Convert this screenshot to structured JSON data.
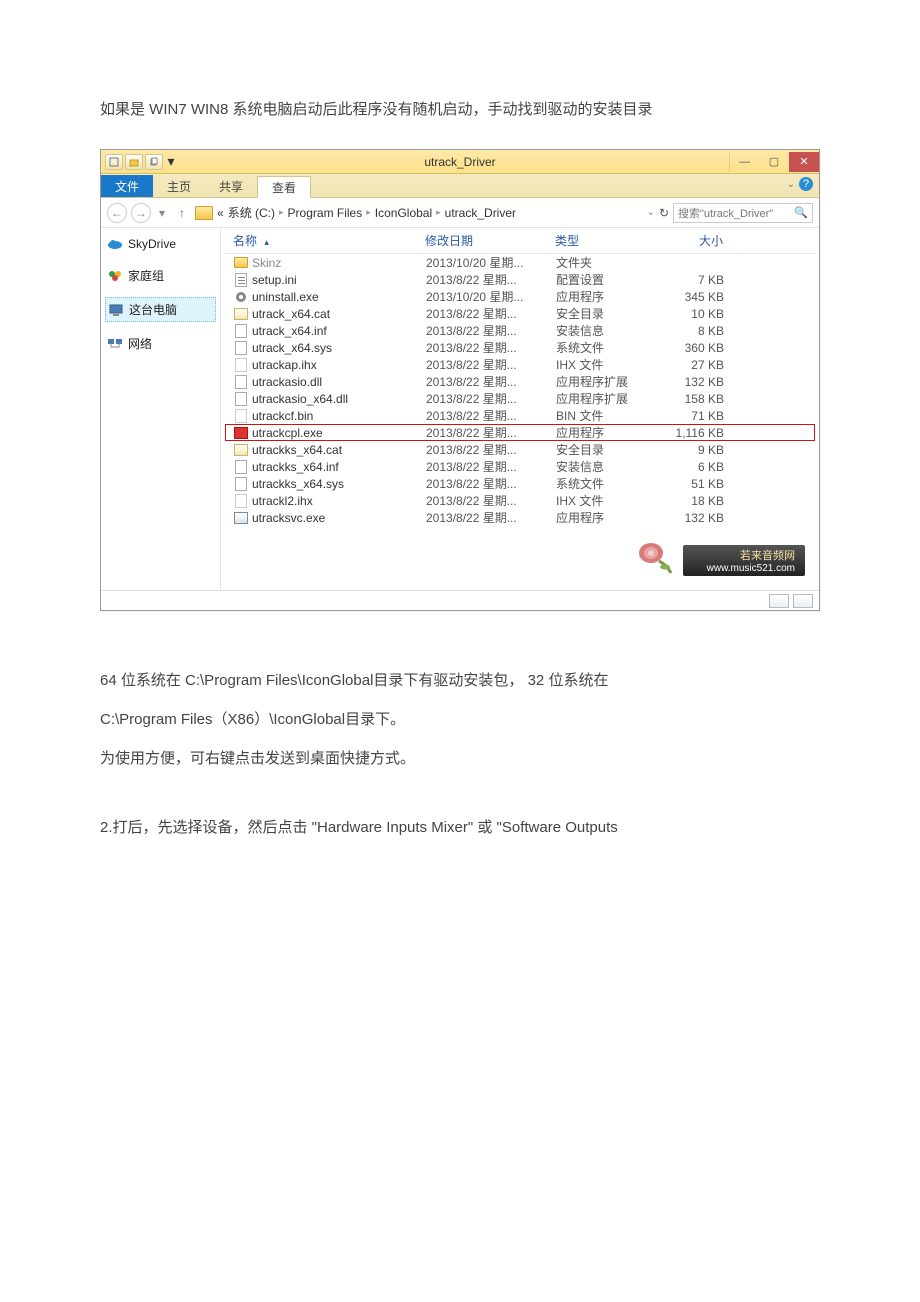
{
  "doc": {
    "line1": "如果是 WIN7  WIN8 系统电脑启动后此程序没有随机启动，手动找到驱动的安装目录",
    "line2": "64 位系统在 C:\\Program Files\\IconGlobal目录下有驱动安装包， 32 位系统在",
    "line3": "C:\\Program Files（X86）\\IconGlobal目录下。",
    "line4": "为使用方便，可右键点击发送到桌面快捷方式。",
    "line5": "2.打后，先选择设备，然后点击 \"Hardware Inputs Mixer\" 或 \"Software Outputs"
  },
  "window": {
    "title": "utrack_Driver",
    "ribbon": {
      "file": "文件",
      "home": "主页",
      "share": "共享",
      "view": "查看"
    },
    "breadcrumb": {
      "prefix": "«",
      "seg1": "系统 (C:)",
      "seg2": "Program Files",
      "seg3": "IconGlobal",
      "seg4": "utrack_Driver"
    },
    "nav": {
      "search_placeholder": "搜索\"utrack_Driver\""
    },
    "columns": {
      "name": "名称",
      "date": "修改日期",
      "type": "类型",
      "size": "大小"
    },
    "sidebar": {
      "skydrive": "SkyDrive",
      "homegroup": "家庭组",
      "thispc": "这台电脑",
      "network": "网络"
    },
    "files": [
      {
        "icon": "folder",
        "name": "Skinz",
        "date": "2013/10/20 星期...",
        "type": "文件夹",
        "size": "",
        "sel": true
      },
      {
        "icon": "ini",
        "name": "setup.ini",
        "date": "2013/8/22 星期...",
        "type": "配置设置",
        "size": "7 KB"
      },
      {
        "icon": "gear",
        "name": "uninstall.exe",
        "date": "2013/10/20 星期...",
        "type": "应用程序",
        "size": "345 KB"
      },
      {
        "icon": "cat",
        "name": "utrack_x64.cat",
        "date": "2013/8/22 星期...",
        "type": "安全目录",
        "size": "10 KB"
      },
      {
        "icon": "inf",
        "name": "utrack_x64.inf",
        "date": "2013/8/22 星期...",
        "type": "安装信息",
        "size": "8 KB"
      },
      {
        "icon": "sys",
        "name": "utrack_x64.sys",
        "date": "2013/8/22 星期...",
        "type": "系统文件",
        "size": "360 KB"
      },
      {
        "icon": "blank",
        "name": "utrackap.ihx",
        "date": "2013/8/22 星期...",
        "type": "IHX 文件",
        "size": "27 KB"
      },
      {
        "icon": "sys",
        "name": "utrackasio.dll",
        "date": "2013/8/22 星期...",
        "type": "应用程序扩展",
        "size": "132 KB"
      },
      {
        "icon": "sys",
        "name": "utrackasio_x64.dll",
        "date": "2013/8/22 星期...",
        "type": "应用程序扩展",
        "size": "158 KB"
      },
      {
        "icon": "blank",
        "name": "utrackcf.bin",
        "date": "2013/8/22 星期...",
        "type": "BIN 文件",
        "size": "71 KB"
      },
      {
        "icon": "redexe",
        "name": "utrackcpl.exe",
        "date": "2013/8/22 星期...",
        "type": "应用程序",
        "size": "1,116 KB",
        "red": true
      },
      {
        "icon": "cat",
        "name": "utrackks_x64.cat",
        "date": "2013/8/22 星期...",
        "type": "安全目录",
        "size": "9 KB"
      },
      {
        "icon": "inf",
        "name": "utrackks_x64.inf",
        "date": "2013/8/22 星期...",
        "type": "安装信息",
        "size": "6 KB"
      },
      {
        "icon": "sys",
        "name": "utrackks_x64.sys",
        "date": "2013/8/22 星期...",
        "type": "系统文件",
        "size": "51 KB"
      },
      {
        "icon": "blank",
        "name": "utrackl2.ihx",
        "date": "2013/8/22 星期...",
        "type": "IHX 文件",
        "size": "18 KB"
      },
      {
        "icon": "exe2",
        "name": "utracksvc.exe",
        "date": "2013/8/22 星期...",
        "type": "应用程序",
        "size": "132 KB"
      }
    ],
    "watermark": {
      "top": "若来音频网",
      "sub": "www.music521.com"
    }
  }
}
